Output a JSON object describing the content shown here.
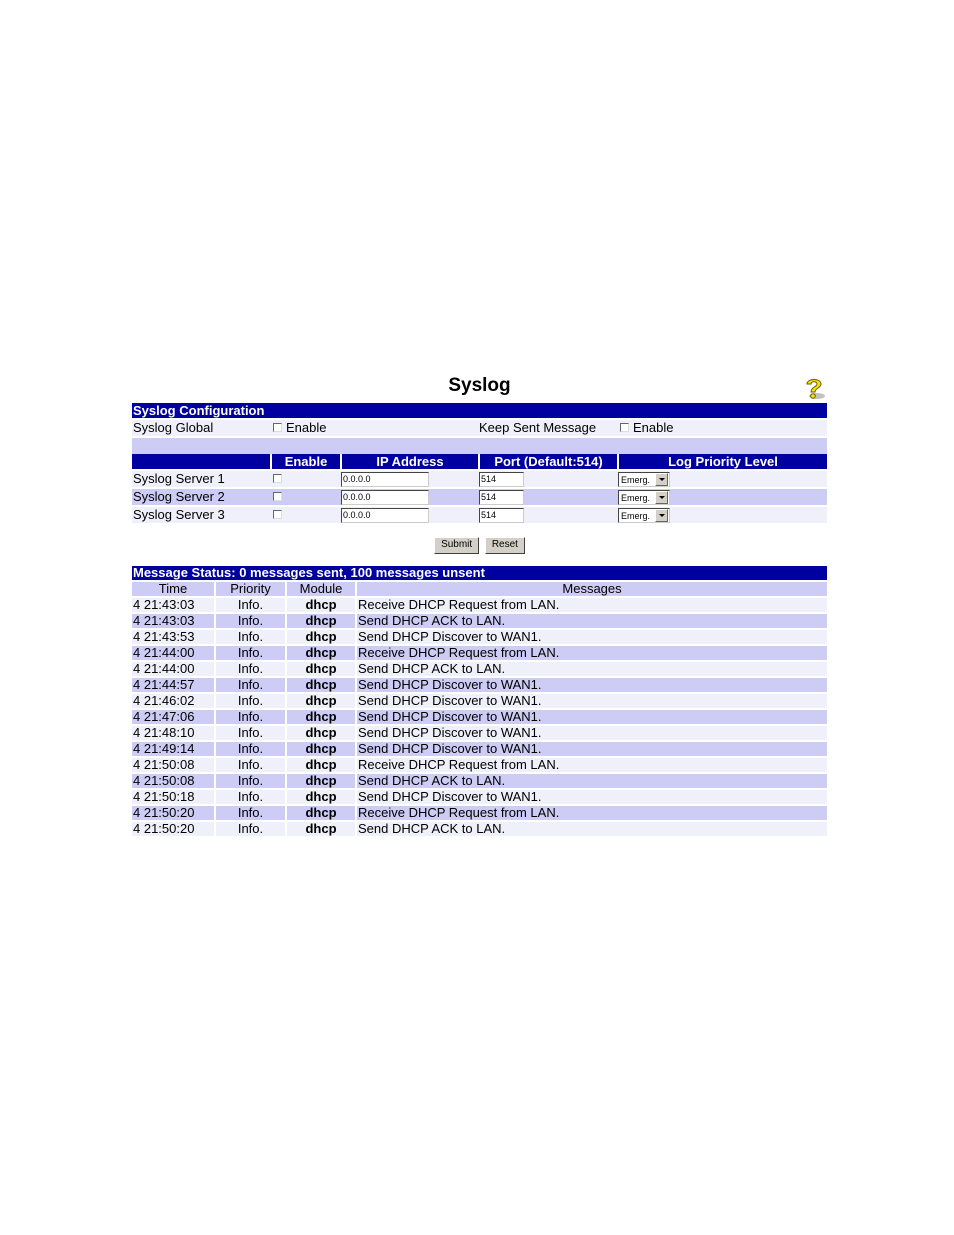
{
  "page": {
    "title": "Syslog",
    "help_icon": "help-question-icon"
  },
  "config": {
    "section_title": "Syslog Configuration",
    "syslog_global_label": "Syslog Global",
    "syslog_global_enable_label": "Enable",
    "syslog_global_checked": false,
    "keep_sent_label": "Keep Sent Message",
    "keep_sent_enable_label": "Enable",
    "keep_sent_checked": false,
    "columns": [
      "",
      "Enable",
      "IP Address",
      "Port (Default:514)",
      "Log Priority Level"
    ],
    "servers": [
      {
        "name": "Syslog Server 1",
        "enabled": false,
        "ip": "0.0.0.0",
        "port": "514",
        "priority": "Emerg."
      },
      {
        "name": "Syslog Server 2",
        "enabled": false,
        "ip": "0.0.0.0",
        "port": "514",
        "priority": "Emerg."
      },
      {
        "name": "Syslog Server 3",
        "enabled": false,
        "ip": "0.0.0.0",
        "port": "514",
        "priority": "Emerg."
      }
    ]
  },
  "buttons": {
    "submit": "Submit",
    "reset": "Reset"
  },
  "messages": {
    "status_title": "Message Status: 0 messages sent, 100 messages unsent",
    "columns": [
      "Time",
      "Priority",
      "Module",
      "Messages"
    ],
    "rows": [
      {
        "time": "4 21:43:03",
        "priority": "Info.",
        "module": "dhcp",
        "message": "Receive DHCP Request from LAN."
      },
      {
        "time": "4 21:43:03",
        "priority": "Info.",
        "module": "dhcp",
        "message": "Send DHCP ACK to LAN."
      },
      {
        "time": "4 21:43:53",
        "priority": "Info.",
        "module": "dhcp",
        "message": "Send DHCP Discover to WAN1."
      },
      {
        "time": "4 21:44:00",
        "priority": "Info.",
        "module": "dhcp",
        "message": "Receive DHCP Request from LAN."
      },
      {
        "time": "4 21:44:00",
        "priority": "Info.",
        "module": "dhcp",
        "message": "Send DHCP ACK to LAN."
      },
      {
        "time": "4 21:44:57",
        "priority": "Info.",
        "module": "dhcp",
        "message": "Send DHCP Discover to WAN1."
      },
      {
        "time": "4 21:46:02",
        "priority": "Info.",
        "module": "dhcp",
        "message": "Send DHCP Discover to WAN1."
      },
      {
        "time": "4 21:47:06",
        "priority": "Info.",
        "module": "dhcp",
        "message": "Send DHCP Discover to WAN1."
      },
      {
        "time": "4 21:48:10",
        "priority": "Info.",
        "module": "dhcp",
        "message": "Send DHCP Discover to WAN1."
      },
      {
        "time": "4 21:49:14",
        "priority": "Info.",
        "module": "dhcp",
        "message": "Send DHCP Discover to WAN1."
      },
      {
        "time": "4 21:50:08",
        "priority": "Info.",
        "module": "dhcp",
        "message": "Receive DHCP Request from LAN."
      },
      {
        "time": "4 21:50:08",
        "priority": "Info.",
        "module": "dhcp",
        "message": "Send DHCP ACK to LAN."
      },
      {
        "time": "4 21:50:18",
        "priority": "Info.",
        "module": "dhcp",
        "message": "Send DHCP Discover to WAN1."
      },
      {
        "time": "4 21:50:20",
        "priority": "Info.",
        "module": "dhcp",
        "message": "Receive DHCP Request from LAN."
      },
      {
        "time": "4 21:50:20",
        "priority": "Info.",
        "module": "dhcp",
        "message": "Send DHCP ACK to LAN."
      }
    ]
  },
  "colors": {
    "header_bar": "#0000a0",
    "row_light": "#f0f0fa",
    "row_dark": "#ccccf5"
  }
}
